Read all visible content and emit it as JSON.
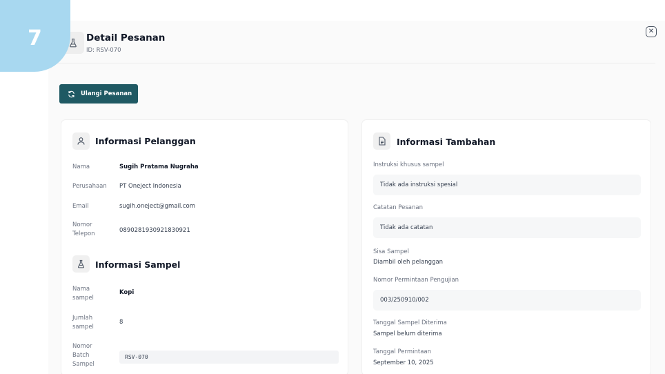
{
  "step": {
    "number": "7"
  },
  "modal": {
    "title": "Detail Pesanan",
    "subtitle": "ID: RSV-070",
    "close_icon": "close-icon"
  },
  "actions": {
    "reorder_label": "Ulangi Pesanan"
  },
  "customer": {
    "title": "Informasi Pelanggan",
    "fields": [
      {
        "label": "Nama",
        "value": "Sugih Pratama Nugraha"
      },
      {
        "label": "Perusahaan",
        "value": "PT Oneject Indonesia"
      },
      {
        "label": "Email",
        "value": "sugih.oneject@gmail.com"
      },
      {
        "label_line1": "Nomor",
        "label_line2": "Telepon",
        "value": "0890281930921830921"
      }
    ]
  },
  "sample": {
    "title": "Informasi Sampel",
    "fields": [
      {
        "label_line1": "Nama",
        "label_line2": "sampel",
        "value": "Kopi"
      },
      {
        "label_line1": "Jumlah",
        "label_line2": "sampel",
        "value": "8"
      },
      {
        "label_line1": "Nomor",
        "label_line2": "Batch",
        "label_line3": "Sampel",
        "value": "RSV-070"
      }
    ]
  },
  "additional": {
    "title": "Informasi Tambahan",
    "special_instructions_label": "Instruksi khusus sampel",
    "special_instructions_value": "Tidak ada instruksi spesial",
    "order_notes_label": "Catatan Pesanan",
    "order_notes_value": "Tidak ada catatan",
    "remaining_sample_label": "Sisa Sampel",
    "remaining_sample_value": "Diambil oleh pelanggan",
    "request_number_label": "Nomor Permintaan Pengujian",
    "request_number_value": "003/250910/002",
    "received_date_label": "Tanggal Sampel Diterima",
    "received_date_value": "Sampel belum diterima",
    "request_date_label": "Tanggal Permintaan",
    "request_date_value": "September 10, 2025"
  },
  "colors": {
    "primary_button": "#1f5963",
    "step_badge": "#a8d8f0"
  }
}
